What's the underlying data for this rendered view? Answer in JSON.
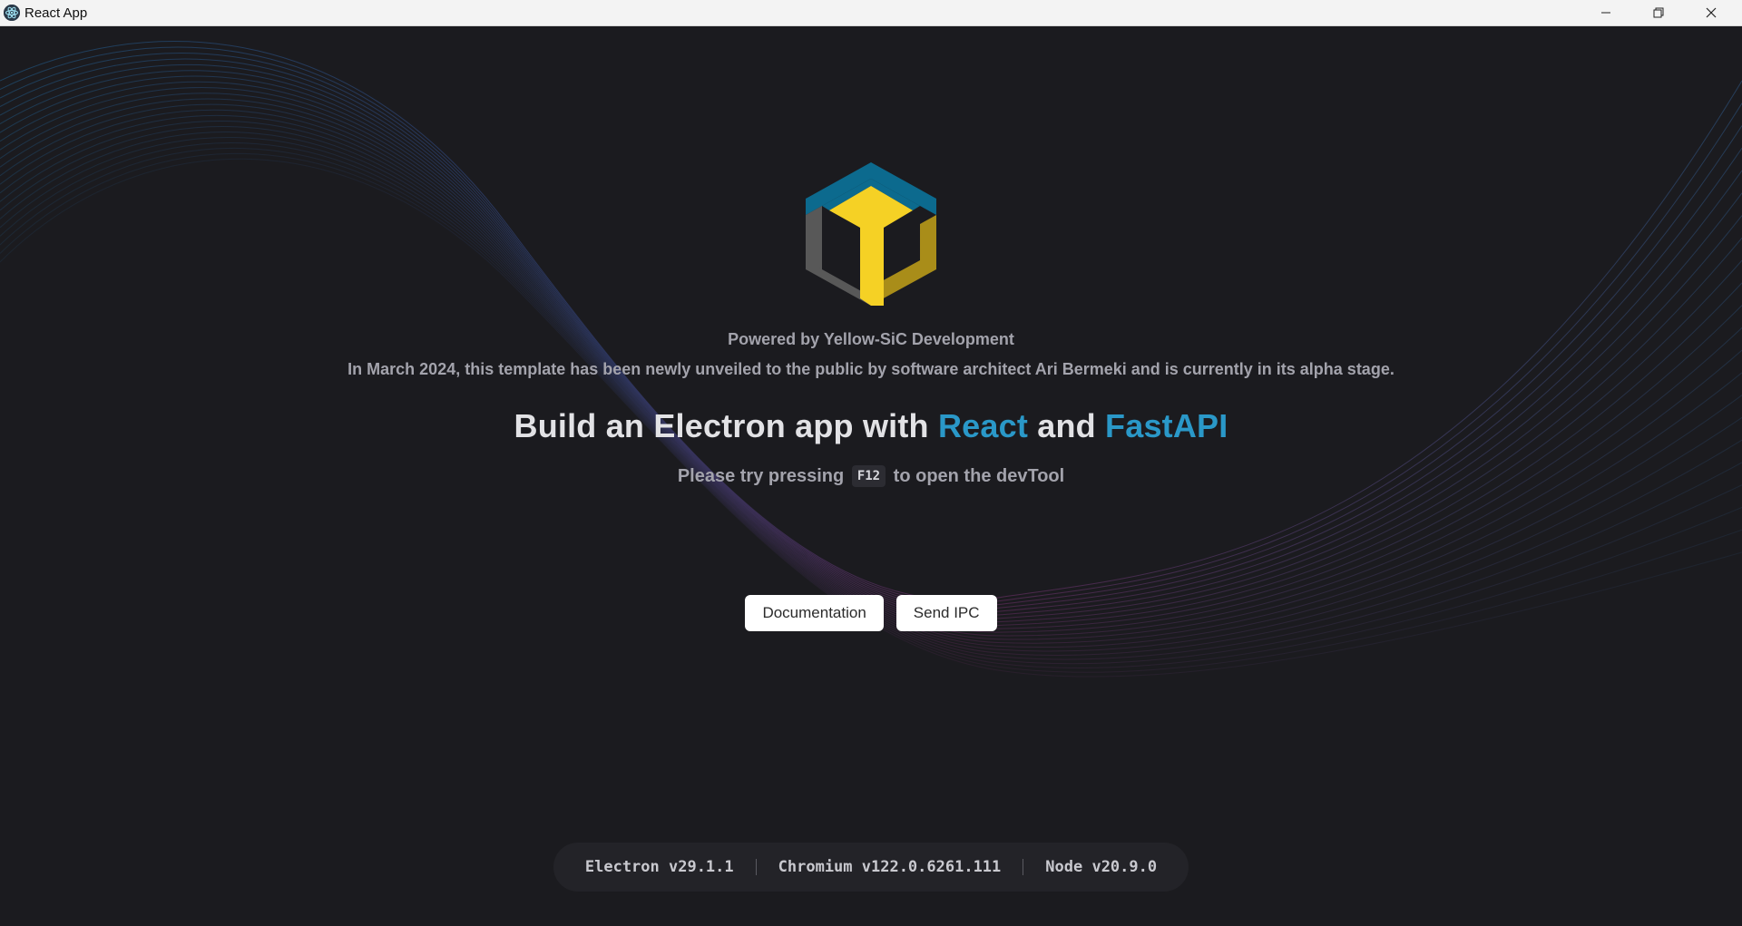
{
  "window": {
    "title": "React App",
    "controls": [
      "minimize-icon",
      "restore-icon",
      "close-icon"
    ]
  },
  "logo": {
    "name": "Yellow-SiC cube logo",
    "colors": {
      "top": "#0c6a8e",
      "left": "#585858",
      "right": "#a98d19",
      "center": "#f5d125"
    }
  },
  "main": {
    "powered_by": "Powered by Yellow-SiC Development",
    "intro": "In March 2024, this template has been newly unveiled to the public by software architect Ari Bermeki and is currently in its alpha stage.",
    "headline": {
      "prefix": "Build an Electron app with ",
      "react": "React",
      "and": " and ",
      "fastapi": "FastAPI"
    },
    "tip": {
      "before": "Please try pressing",
      "key": "F12",
      "after": "to open the devTool"
    }
  },
  "actions": {
    "documentation": "Documentation",
    "send_ipc": "Send IPC"
  },
  "versions": {
    "electron": "Electron v29.1.1",
    "chromium": "Chromium v122.0.6261.111",
    "node": "Node v20.9.0"
  },
  "colors": {
    "background": "#1b1b1f",
    "accent": "#2a98c8",
    "text_muted": "#a3a3ac",
    "headline": "#e2e2e5"
  }
}
